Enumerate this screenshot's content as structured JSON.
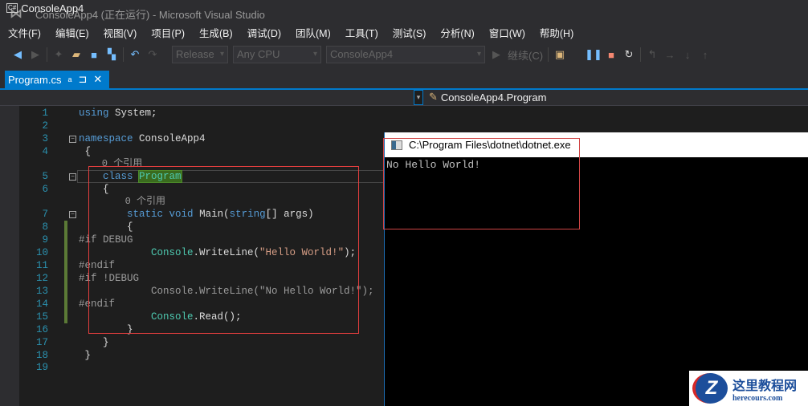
{
  "window": {
    "title": "ConsoleApp4 (正在运行) - Microsoft Visual Studio"
  },
  "menu": [
    "文件(F)",
    "编辑(E)",
    "视图(V)",
    "项目(P)",
    "生成(B)",
    "调试(D)",
    "团队(M)",
    "工具(T)",
    "测试(S)",
    "分析(N)",
    "窗口(W)",
    "帮助(H)"
  ],
  "toolbar": {
    "config": "Release",
    "platform": "Any CPU",
    "project": "ConsoleApp4",
    "continue": "继续(C)"
  },
  "tab": {
    "label": "Program.cs",
    "pin": "⊐",
    "close": "✕",
    "lock": "🔒"
  },
  "navbar": {
    "project": "ConsoleApp4",
    "class": "ConsoleApp4.Program",
    "cs_badge": "C#"
  },
  "code": [
    {
      "n": "1",
      "segs": [
        [
          "using",
          "kw"
        ],
        [
          " System;",
          "tx"
        ]
      ]
    },
    {
      "n": "2",
      "segs": []
    },
    {
      "n": "3",
      "fold": true,
      "segs": [
        [
          "namespace",
          "kw"
        ],
        [
          " ConsoleApp4",
          "tx"
        ]
      ]
    },
    {
      "n": "4",
      "segs": [
        [
          " {",
          "tx"
        ]
      ]
    },
    {
      "n": "",
      "segs": [
        [
          "    0 个引用",
          "lens"
        ]
      ]
    },
    {
      "n": "5",
      "fold": true,
      "segs": [
        [
          "    ",
          "tx"
        ],
        [
          "class",
          "kw"
        ],
        [
          " ",
          "tx"
        ],
        [
          "Program",
          "hl"
        ]
      ]
    },
    {
      "n": "6",
      "segs": [
        [
          "    {",
          "tx"
        ]
      ]
    },
    {
      "n": "",
      "segs": [
        [
          "        0 个引用",
          "lens"
        ]
      ]
    },
    {
      "n": "7",
      "fold": true,
      "segs": [
        [
          "        ",
          "tx"
        ],
        [
          "static",
          "kw"
        ],
        [
          " ",
          "tx"
        ],
        [
          "void",
          "kw"
        ],
        [
          " Main(",
          "tx"
        ],
        [
          "string",
          "kw"
        ],
        [
          "[] args)",
          "tx"
        ]
      ]
    },
    {
      "n": "8",
      "segs": [
        [
          "        {",
          "tx"
        ]
      ]
    },
    {
      "n": "9",
      "segs": [
        [
          "#if DEBUG",
          "pp"
        ]
      ]
    },
    {
      "n": "10",
      "segs": [
        [
          "            ",
          "tx"
        ],
        [
          "Console",
          "ty"
        ],
        [
          ".WriteLine(",
          "tx"
        ],
        [
          "\"Hello World!\"",
          "str"
        ],
        [
          ");",
          "tx"
        ]
      ]
    },
    {
      "n": "11",
      "segs": [
        [
          "#endif",
          "pp"
        ]
      ]
    },
    {
      "n": "12",
      "segs": [
        [
          "#if !DEBUG",
          "pp"
        ]
      ]
    },
    {
      "n": "13",
      "segs": [
        [
          "            Console.WriteLine(\"No Hello World!\");",
          "gray"
        ]
      ]
    },
    {
      "n": "14",
      "segs": [
        [
          "#endif",
          "pp"
        ]
      ]
    },
    {
      "n": "15",
      "segs": [
        [
          "            ",
          "tx"
        ],
        [
          "Console",
          "ty"
        ],
        [
          ".Read();",
          "tx"
        ]
      ]
    },
    {
      "n": "16",
      "segs": [
        [
          "        }",
          "tx"
        ]
      ]
    },
    {
      "n": "17",
      "segs": [
        [
          "    }",
          "tx"
        ]
      ]
    },
    {
      "n": "18",
      "segs": [
        [
          " }",
          "tx"
        ]
      ]
    },
    {
      "n": "19",
      "segs": []
    }
  ],
  "console": {
    "title": "C:\\Program Files\\dotnet\\dotnet.exe",
    "output": "No Hello World!"
  },
  "watermark": {
    "cn": "这里教程网",
    "en": "herecours.com",
    "logo": "Z"
  }
}
